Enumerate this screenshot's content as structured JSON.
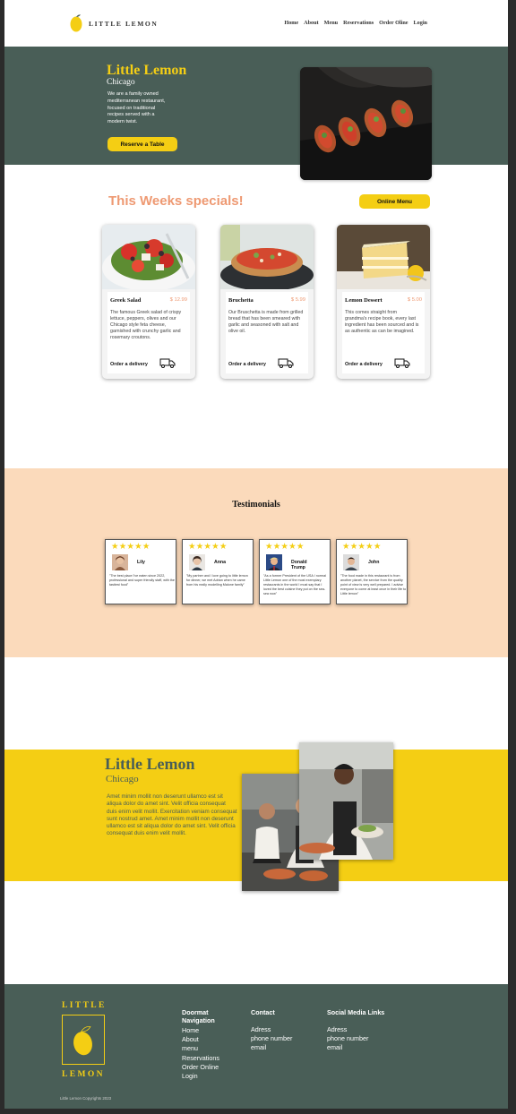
{
  "brand": {
    "name": "LITTLE LEMON",
    "footer_top": "LITTLE",
    "footer_bottom": "LEMON",
    "colors": {
      "green": "#495e57",
      "yellow": "#f4ce14",
      "salmon": "#ee9972",
      "peach": "#fbdabb"
    }
  },
  "nav": {
    "items": [
      "Home",
      "About",
      "Menu",
      "Reservations",
      "Order Oline",
      "Login"
    ]
  },
  "hero": {
    "title": "Little Lemon",
    "city": "Chicago",
    "description": "We are a family owned mediterranean restaurant, focused on traditional recipes served with a modern twist.",
    "button": "Reserve a Table"
  },
  "specials": {
    "title": "This Weeks specials!",
    "button": "Online Menu",
    "order_label": "Order a delivery",
    "truck_icon": "delivery-truck-icon",
    "dishes": [
      {
        "name": "Greek Salad",
        "price": "$ 12.99",
        "description": "The famous Greek salad of crispy lettuce, peppers, olives and our Chicago style feta cheese, garnished with crunchy garlic and rosemary croutons."
      },
      {
        "name": "Bruchetta",
        "price": "$ 5.99",
        "description": "Our Bruschetta is made from grilled bread that has been smeared with garlic and seasoned with salt and olive oil."
      },
      {
        "name": "Lemon Dessert",
        "price": "$ 5.00",
        "description": "This comes straight from grandma's recipe book, every last ingredient has been sourced and is as authentic as can be imagined."
      }
    ]
  },
  "testimonials": {
    "title": "Testimonials",
    "stars": "★★★★★",
    "items": [
      {
        "name": "Lily",
        "quote": "\"The best place I've eaten since 2022, professional and super friendly staff, with the tastiest food\""
      },
      {
        "name": "Anna",
        "quote": "\"My partner and I love going to little lemon for dinner, we met Adrian when he came from his really modelling Malone family\""
      },
      {
        "name": "Donald Trump",
        "quote": "\"As a former President of the USA I normal Little Lemon one of the most exemplary restaurants in the world I must say that I loved the best cuisine they put on the sea-sea now\""
      },
      {
        "name": "John",
        "quote": "\"The food made in this restaurant is from another planet, the service from the quality point of view is very well prepared. I advise everyone to come at least once in their life to Little lemon\""
      }
    ]
  },
  "about": {
    "title": "Little Lemon",
    "city": "Chicago",
    "description": "Amet minim mollit non deserunt ullamco est sit aliqua dolor do amet sint. Velit officia consequat duis enim velit mollit. Exercitation veniam consequat sunt nostrud amet. Amet minim mollit non deserunt ullamco est sit aliqua dolor do amet sint. Velit officia consequat duis enim velit mollit."
  },
  "footer": {
    "nav_title": "Doormat Navigation",
    "nav_items": [
      "Home",
      "About",
      "menu",
      "Reservations",
      "Order Online",
      "Login"
    ],
    "contact_title": "Contact",
    "contact_items": [
      "Adress",
      "phone number",
      "email"
    ],
    "social_title": "Social Media Links",
    "social_items": [
      "Adress",
      "phone number",
      "email"
    ],
    "copyright": "Little Lemon Copyrights 2023"
  }
}
